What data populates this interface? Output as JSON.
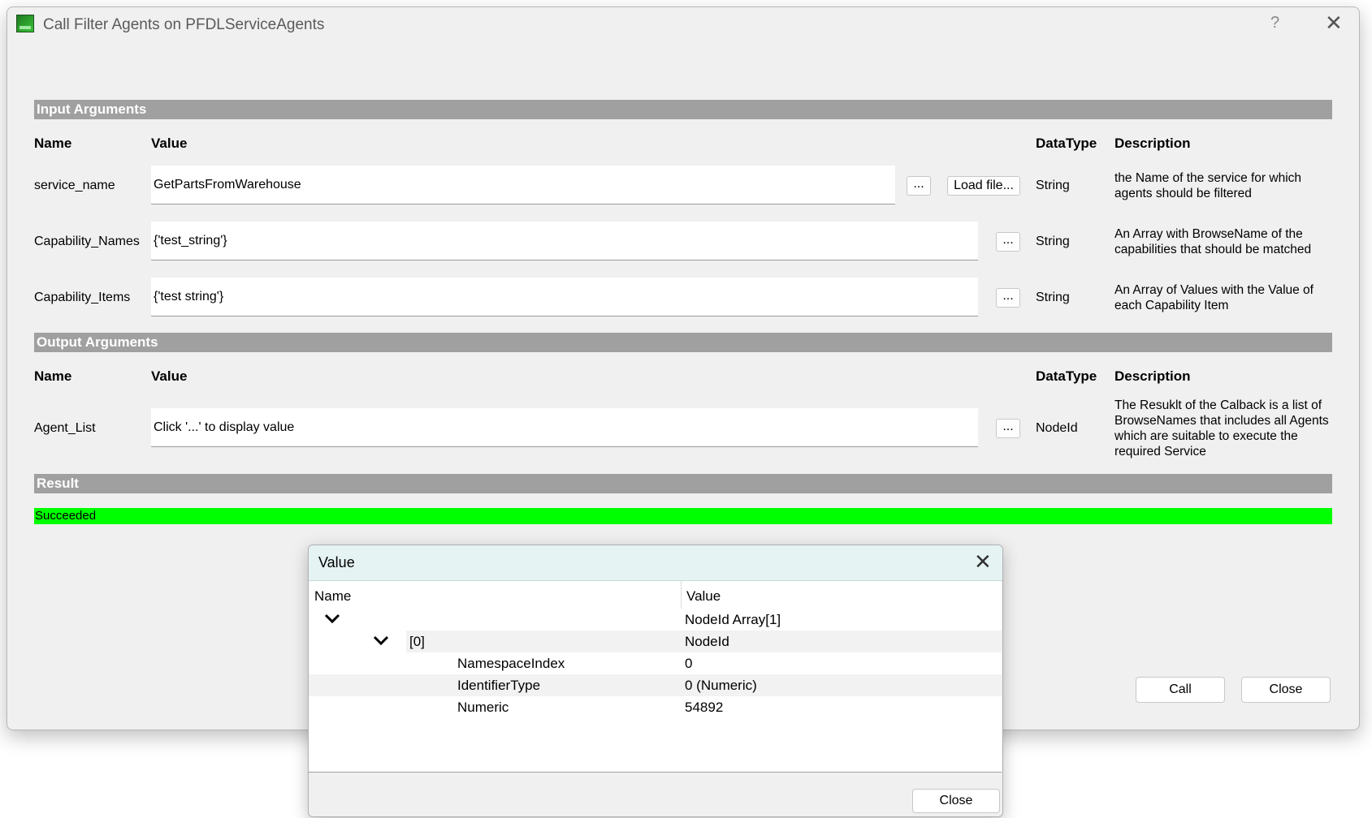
{
  "window": {
    "title": "Call Filter Agents on PFDLServiceAgents",
    "help_label": "?"
  },
  "input_section": {
    "header": "Input Arguments",
    "columns": {
      "name": "Name",
      "value": "Value",
      "datatype": "DataType",
      "description": "Description"
    },
    "rows": [
      {
        "name": "service_name",
        "value": "GetPartsFromWarehouse",
        "datatype": "String",
        "description": "the Name of the service for which agents should be filtered",
        "browse_label": "...",
        "load_label": "Load file..."
      },
      {
        "name": "Capability_Names",
        "value": "{'test_string'}",
        "datatype": "String",
        "description": "An Array with BrowseName of the capabilities that should be matched",
        "browse_label": "..."
      },
      {
        "name": "Capability_Items",
        "value": "{'test string'}",
        "datatype": "String",
        "description": "An Array of Values with the Value of each Capability Item",
        "browse_label": "..."
      }
    ]
  },
  "output_section": {
    "header": "Output Arguments",
    "columns": {
      "name": "Name",
      "value": "Value",
      "datatype": "DataType",
      "description": "Description"
    },
    "rows": [
      {
        "name": "Agent_List",
        "value": "Click '...' to display value",
        "datatype": "NodeId",
        "description": "The Resuklt of the Calback is a list of BrowseNames that includes all Agents which are suitable to execute the required Service",
        "browse_label": "..."
      }
    ]
  },
  "result_section": {
    "header": "Result",
    "status": "Succeeded",
    "status_color": "#00ff00"
  },
  "buttons": {
    "call": "Call",
    "close": "Close"
  },
  "value_dialog": {
    "title": "Value",
    "columns": {
      "name": "Name",
      "value": "Value"
    },
    "rows": [
      {
        "name": "",
        "value": "NodeId Array[1]"
      },
      {
        "name": "[0]",
        "value": "NodeId"
      },
      {
        "name": "NamespaceIndex",
        "value": "0"
      },
      {
        "name": "IdentifierType",
        "value": "0 (Numeric)"
      },
      {
        "name": "Numeric",
        "value": "54892"
      }
    ],
    "close_label": "Close"
  }
}
